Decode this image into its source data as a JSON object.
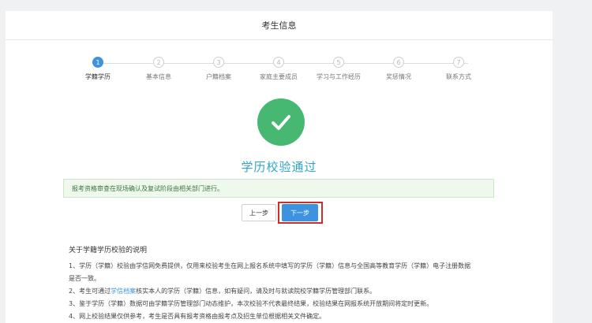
{
  "header": {
    "title": "考生信息"
  },
  "steps": [
    {
      "num": "1",
      "label": "学籍学历",
      "active": true
    },
    {
      "num": "2",
      "label": "基本信息",
      "active": false
    },
    {
      "num": "3",
      "label": "户籍档案",
      "active": false
    },
    {
      "num": "4",
      "label": "家庭主要成员",
      "active": false
    },
    {
      "num": "5",
      "label": "学习与工作经历",
      "active": false
    },
    {
      "num": "6",
      "label": "奖惩情况",
      "active": false
    },
    {
      "num": "7",
      "label": "联系方式",
      "active": false
    }
  ],
  "result": {
    "title": "学历校验通过",
    "notice": "报考资格审查在现场确认及复试阶段由相关部门进行。",
    "icon": "check-icon"
  },
  "buttons": {
    "prev": "上一步",
    "next": "下一步"
  },
  "explanation": {
    "heading": "关于学籍学历校验的说明",
    "item1": "1、学历（学籍）校验由学信网免费提供，仅用来校验考生在网上报名系统中填写的学历（学籍）信息与全国高等教育学历（学籍）电子注册数据",
    "item1_cont": "是否一致。",
    "item2_pre": "2、考生可通过",
    "item2_link": "学信档案",
    "item2_post": "核实本人的学历（学籍）信息，如有疑问，请及时与就读院校学籍学历管理部门联系。",
    "item3": "3、鉴于学历（学籍）数据可由学籍学历管理部门动态维护，本次校验不代表最终结果，校验结果在网报系统开放期间将定时更新。",
    "item4": "4、网上校验结果仅供参考，考生是否具有报考资格由报考点及招生单位根据相关文件确定。"
  },
  "colors": {
    "primary": "#3d93e0",
    "success": "#47b872",
    "highlight_border": "#c9302c",
    "title_text": "#2fa5cc"
  }
}
